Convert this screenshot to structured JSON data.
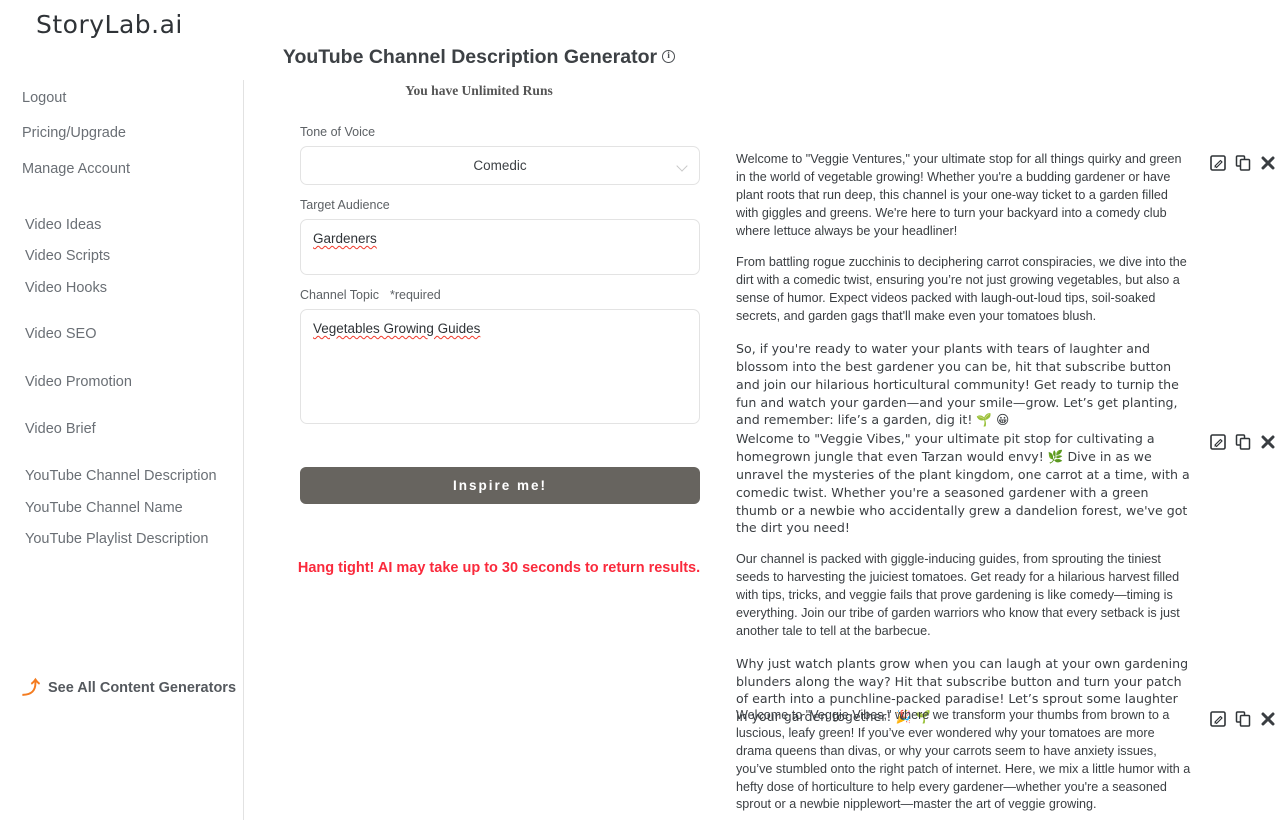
{
  "brand": "StoryLab.ai",
  "sidebar": {
    "account_links": [
      {
        "label": "Logout",
        "name": "logout"
      },
      {
        "label": "Pricing/Upgrade",
        "name": "pricing-upgrade"
      },
      {
        "label": "Manage Account",
        "name": "manage-account"
      }
    ],
    "main_links": [
      {
        "label": "Video Ideas",
        "name": "video-ideas"
      },
      {
        "label": "Video Scripts",
        "name": "video-scripts"
      },
      {
        "label": "Video Hooks",
        "name": "video-hooks"
      },
      {
        "label": "Video SEO",
        "name": "video-seo"
      },
      {
        "label": "Video Promotion",
        "name": "video-promotion"
      },
      {
        "label": "Video Brief",
        "name": "video-brief"
      },
      {
        "label": "YouTube Channel Description",
        "name": "youtube-channel-description"
      },
      {
        "label": "YouTube Channel Name",
        "name": "youtube-channel-name"
      },
      {
        "label": "YouTube Playlist Description",
        "name": "youtube-playlist-description"
      }
    ],
    "see_all": "See All Content Generators",
    "see_all_icon": "back-arrow-icon",
    "accent_color": "#f47c20"
  },
  "header": {
    "title": "YouTube Channel Description Generator",
    "info_icon": "info-circle-icon",
    "runs_text": "You have Unlimited Runs"
  },
  "form": {
    "tone": {
      "label": "Tone of Voice",
      "value": "Comedic",
      "chevron_icon": "chevron-down-icon"
    },
    "audience": {
      "label": "Target Audience",
      "value": "Gardeners",
      "placeholder": ""
    },
    "topic": {
      "label": "Channel Topic",
      "required_note": "*required",
      "value": "Vegetables Growing Guides",
      "placeholder": ""
    },
    "submit_label": "Inspire me!",
    "notice": "Hang tight! AI may take up to 30 seconds to return results.",
    "notice_color": "#fa2a3c",
    "submit_bg": "#67645f"
  },
  "results": {
    "action_icons": [
      "edit-icon",
      "copy-icon",
      "close-icon"
    ],
    "blocks": [
      {
        "paragraphs": [
          "Welcome to \"Veggie Ventures,\" your ultimate stop for all things quirky and green in the world of vegetable growing! Whether you're a budding gardener or have plant roots that run deep, this channel is your one-way ticket to a garden filled with giggles and greens. We're here to turn your backyard into a comedy club where lettuce always be your headliner!",
          "From battling rogue zucchinis to deciphering carrot conspiracies, we dive into the dirt with a comedic twist, ensuring you’re not just growing vegetables, but also a sense of humor. Expect videos packed with laugh-out-loud tips, soil-soaked secrets, and garden gags that'll make even your tomatoes blush.",
          "So, if you're ready to water your plants with tears of laughter and blossom into the best gardener you can be, hit that subscribe button and join our hilarious horticultural community! Get ready to turnip the fun and watch your garden—and your smile—grow. Let’s get planting, and remember: life’s a garden, dig it! 🌱 😀"
        ]
      },
      {
        "paragraphs": [
          "Welcome to \"Veggie Vibes,\" your ultimate pit stop for cultivating a homegrown jungle that even Tarzan would envy! 🌿 Dive in as we unravel the mysteries of the plant kingdom, one carrot at a time, with a comedic twist. Whether you're a seasoned gardener with a green thumb or a newbie who accidentally grew a dandelion forest, we've got the dirt you need!",
          "Our channel is packed with giggle-inducing guides, from sprouting the tiniest seeds to harvesting the juiciest tomatoes. Get ready for a hilarious harvest filled with tips, tricks, and veggie fails that prove gardening is like comedy—timing is everything. Join our tribe of garden warriors who know that every setback is just another tale to tell at the barbecue.",
          "Why just watch plants grow when you can laugh at your own gardening blunders along the way? Hit that subscribe button and turn your patch of earth into a punchline-packed paradise! Let’s sprout some laughter in your garden together! 🎉 🌱"
        ]
      },
      {
        "paragraphs": [
          "Welcome to \"Veggie Vibes,\" where we transform your thumbs from brown to a luscious, leafy green! If you’ve ever wondered why your tomatoes are more drama queens than divas, or why your carrots seem to have anxiety issues, you’ve stumbled onto the right patch of internet. Here, we mix a little humor with a hefty dose of horticulture to help every gardener—whether you're a seasoned sprout or a newbie nipplewort—master the art of veggie growing."
        ]
      }
    ]
  }
}
